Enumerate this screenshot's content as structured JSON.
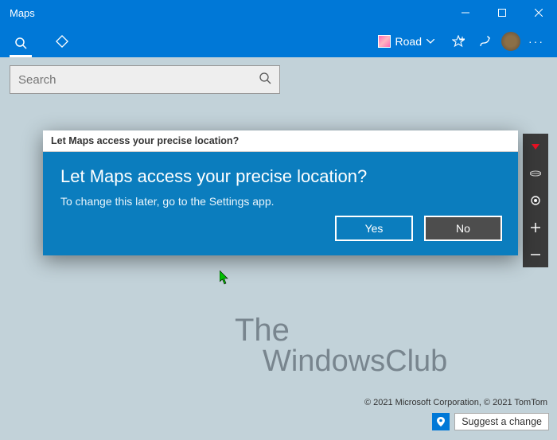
{
  "app": {
    "title": "Maps"
  },
  "toolbar": {
    "map_style_label": "Road"
  },
  "search": {
    "placeholder": "Search"
  },
  "dialog": {
    "title": "Let Maps access your precise location?",
    "heading": "Let Maps access your precise location?",
    "subtext": "To change this later, go to the Settings app.",
    "yes": "Yes",
    "no": "No"
  },
  "footer": {
    "copyright": "© 2021 Microsoft Corporation, © 2021 TomTom",
    "suggest": "Suggest a change"
  },
  "watermark": {
    "line1": "The",
    "line2": "WindowsClub"
  }
}
